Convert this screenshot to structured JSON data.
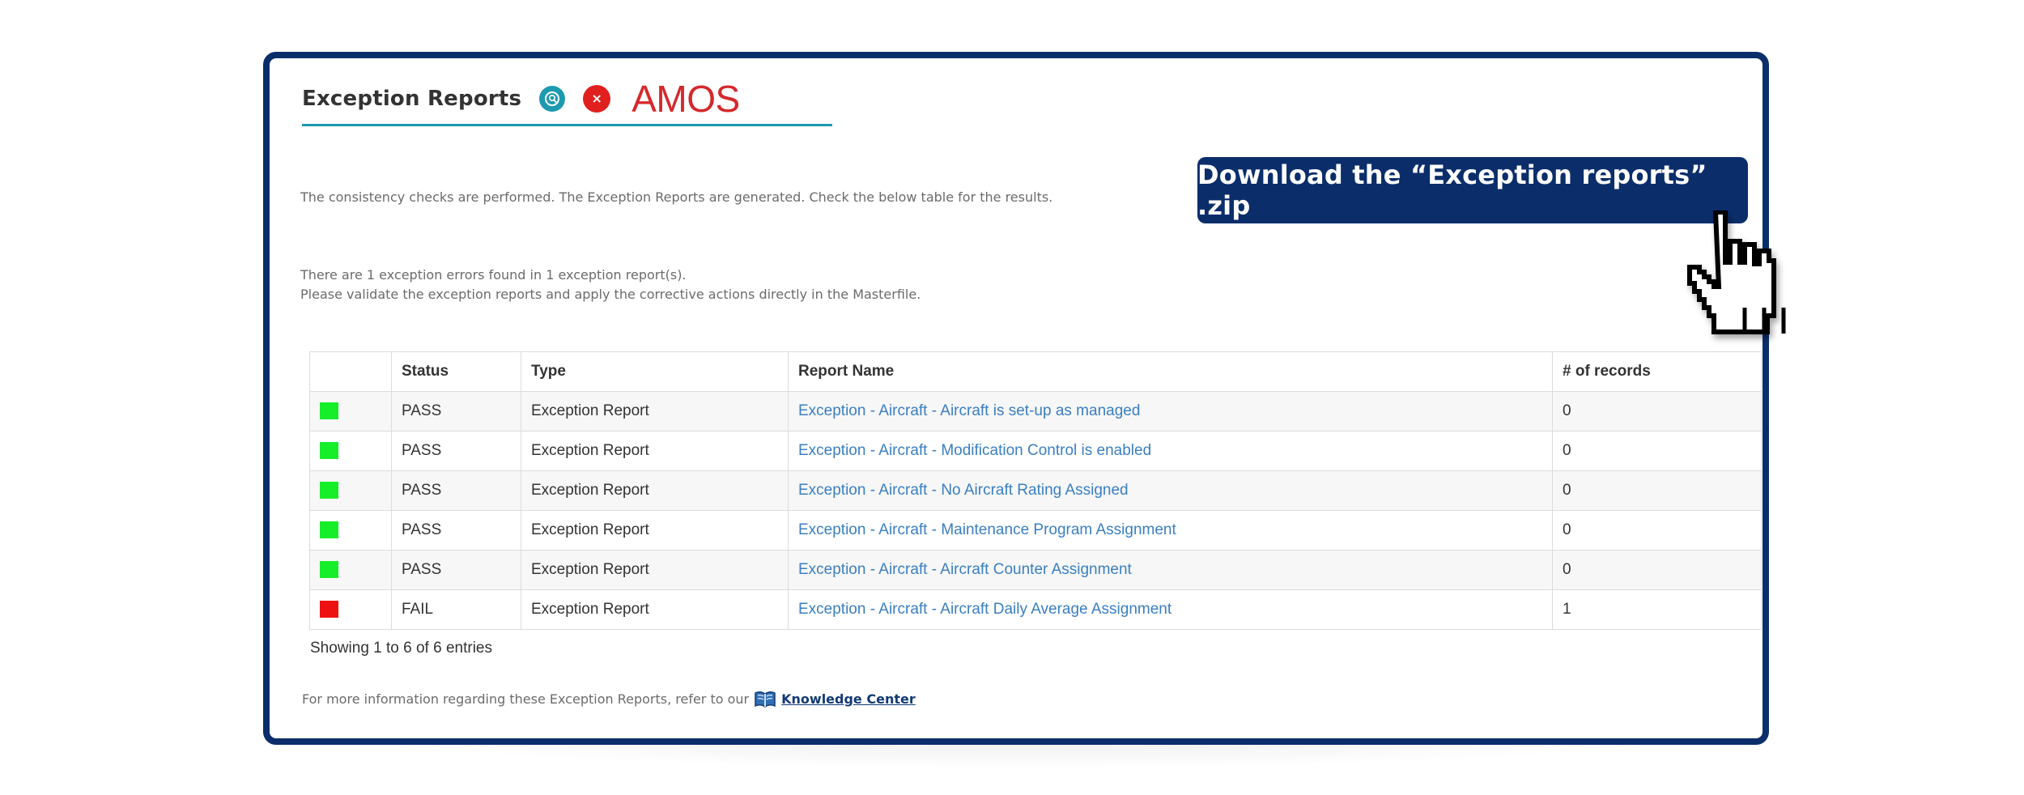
{
  "header": {
    "title": "Exception Reports",
    "help_icon": "help-search-icon",
    "close_icon": "close-icon",
    "close_glyph": "×",
    "brand": "AMOS"
  },
  "messages": {
    "performed": "The consistency checks are performed. The Exception Reports are generated. Check the below table for the results.",
    "errors_found": "There are 1 exception errors found in 1 exception report(s).",
    "validate": "Please validate the exception reports and apply the corrective actions directly in the Masterfile."
  },
  "callout": {
    "download_label": "Download the “Exception reports” .zip",
    "cursor_icon": "hand-pointer-icon"
  },
  "table": {
    "columns": [
      "",
      "Status",
      "Type",
      "Report Name",
      "# of records"
    ],
    "rows": [
      {
        "indicator": "green",
        "status": "PASS",
        "type": "Exception Report",
        "name": "Exception - Aircraft - Aircraft is set-up as managed",
        "records": "0"
      },
      {
        "indicator": "green",
        "status": "PASS",
        "type": "Exception Report",
        "name": "Exception - Aircraft - Modification Control is enabled",
        "records": "0"
      },
      {
        "indicator": "green",
        "status": "PASS",
        "type": "Exception Report",
        "name": "Exception - Aircraft - No Aircraft Rating Assigned",
        "records": "0"
      },
      {
        "indicator": "green",
        "status": "PASS",
        "type": "Exception Report",
        "name": "Exception - Aircraft - Maintenance Program Assignment",
        "records": "0"
      },
      {
        "indicator": "green",
        "status": "PASS",
        "type": "Exception Report",
        "name": "Exception - Aircraft - Aircraft Counter Assignment",
        "records": "0"
      },
      {
        "indicator": "red",
        "status": "FAIL",
        "type": "Exception Report",
        "name": "Exception - Aircraft - Aircraft Daily Average Assignment",
        "records": "1"
      }
    ],
    "showing": "Showing 1 to 6 of 6 entries"
  },
  "footer": {
    "text": "For more information regarding these Exception Reports, refer to our",
    "link_icon": "book-icon",
    "link_label": "Knowledge Center"
  },
  "colors": {
    "navy": "#0b2e6b",
    "teal": "#1d9ab0",
    "brand_red": "#d4292c",
    "pass": "#17ee2a",
    "fail": "#ee1111",
    "link": "#3a7fc1"
  }
}
